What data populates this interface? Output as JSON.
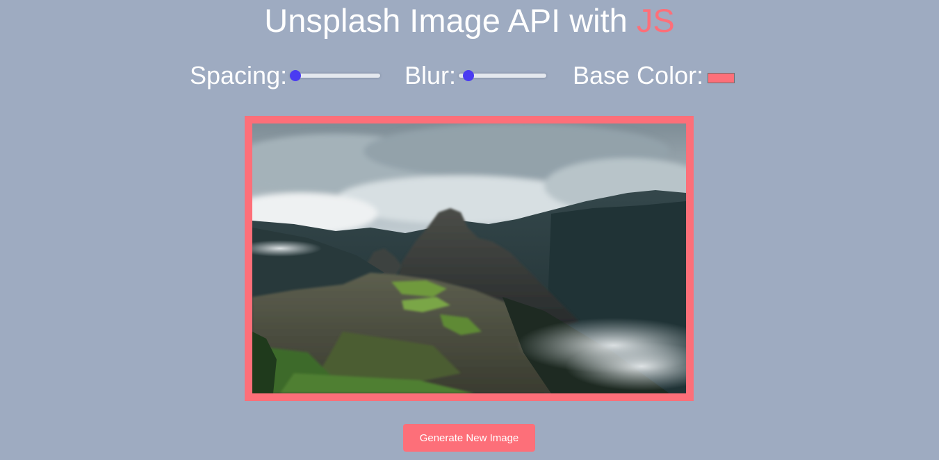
{
  "header": {
    "title_main": "Unsplash Image API with ",
    "title_accent": "JS",
    "accent_color": "#fd6f79"
  },
  "controls": {
    "spacing": {
      "label": "Spacing:",
      "value_fraction": 0.0
    },
    "blur": {
      "label": "Blur:",
      "value_fraction": 0.05
    },
    "base_color": {
      "label": "Base Color:",
      "value": "#fd6f79"
    }
  },
  "image": {
    "alt": "Machu Picchu mountain landscape under cloudy sky"
  },
  "actions": {
    "generate_label": "Generate New Image"
  },
  "colors": {
    "background": "#9eabc1",
    "slider_thumb": "#4a3bf2"
  }
}
